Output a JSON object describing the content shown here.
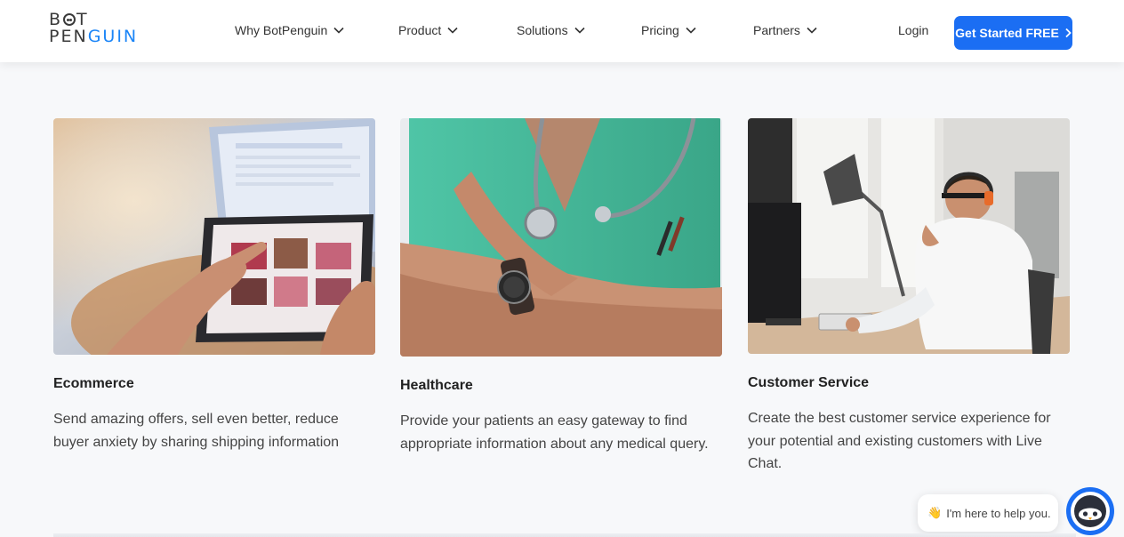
{
  "brand": {
    "line1": "BOT",
    "line2a": "PEN",
    "line2b": "GUIN",
    "accent": "#1b85f7"
  },
  "nav": {
    "items": [
      {
        "label": "Why BotPenguin"
      },
      {
        "label": "Product"
      },
      {
        "label": "Solutions"
      },
      {
        "label": "Pricing"
      },
      {
        "label": "Partners"
      }
    ],
    "login": "Login",
    "cta": "Get Started FREE",
    "cta_color": "#1b6ef3"
  },
  "cards": [
    {
      "title": "Ecommerce",
      "description": "Send amazing offers, sell even better, reduce buyer anxiety by sharing shipping information",
      "image": "person-using-tablet-shopping"
    },
    {
      "title": "Healthcare",
      "description": "Provide your patients an easy gateway to find appropriate information about any medical query.",
      "image": "doctor-with-stethoscope"
    },
    {
      "title": "Customer Service",
      "description": "Create the best customer service experience for your potential and existing customers with Live Chat.",
      "image": "support-agent-with-headset"
    }
  ],
  "chat": {
    "emoji": "👋",
    "message": "I'm here to help you.",
    "icon": "penguin-bot-icon"
  }
}
